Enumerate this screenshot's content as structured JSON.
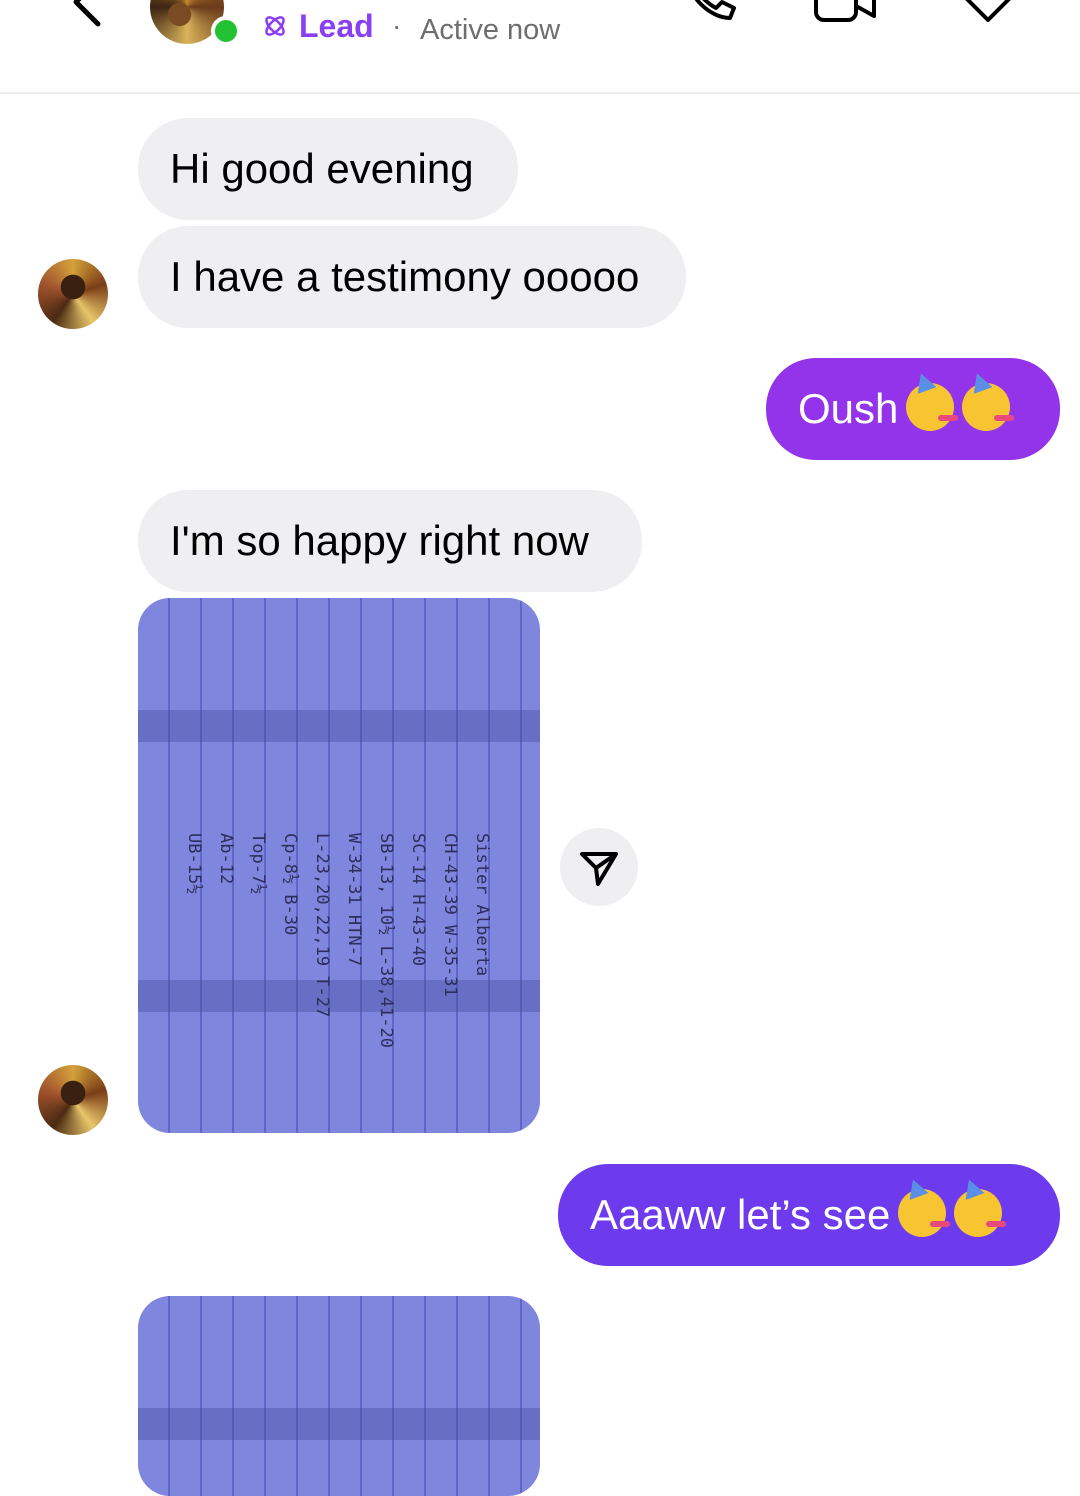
{
  "header": {
    "contact_label": "Lead",
    "separator": "·",
    "status": "Active now",
    "icons": [
      "back-chevron-icon",
      "phone-icon",
      "video-icon",
      "tag-icon"
    ]
  },
  "messages": [
    {
      "id": 1,
      "direction": "incoming",
      "text": "Hi good evening"
    },
    {
      "id": 2,
      "direction": "incoming",
      "text": "I have a testimony ooooo"
    },
    {
      "id": 3,
      "direction": "outgoing",
      "text": "Oush",
      "emojis": [
        "partying-face",
        "partying-face"
      ]
    },
    {
      "id": 4,
      "direction": "incoming",
      "text": "I'm so happy right now"
    },
    {
      "id": 5,
      "direction": "incoming",
      "type": "photo",
      "photo_lines": [
        "Sister Alberta",
        "CH-43-39   W-35-31",
        "SC-14   H-43-40",
        "SB-13, 10½   L-38,41-20",
        "W-34-31   HTN-7",
        "L-23,20,22,19   T-27",
        "Cp-8½   B-30",
        "Top-7½",
        "Ab-12",
        "UB-15½"
      ]
    },
    {
      "id": 6,
      "direction": "outgoing",
      "text": "Aaaww let’s see",
      "emojis": [
        "partying-face",
        "partying-face"
      ]
    },
    {
      "id": 7,
      "direction": "incoming",
      "type": "photo"
    }
  ],
  "colors": {
    "accent": "#8a3ff2",
    "online": "#21c132",
    "incoming_bubble": "#efeff1",
    "outgoing_bubble_1": "#9333ea",
    "outgoing_bubble_2": "#6d3aee"
  }
}
